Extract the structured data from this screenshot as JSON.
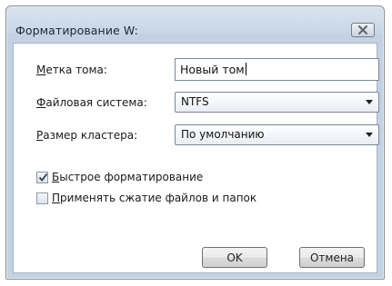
{
  "window": {
    "title": "Форматирование W:",
    "close_icon": "close-icon"
  },
  "form": {
    "volume_label": {
      "mnemonic": "М",
      "rest": "етка тома:",
      "value": "Новый том"
    },
    "filesystem": {
      "mnemonic": "Ф",
      "rest": "айловая система:",
      "selected": "NTFS"
    },
    "cluster_size": {
      "mnemonic": "Р",
      "rest": "азмер кластера:",
      "selected": "По умолчанию"
    }
  },
  "options": {
    "quick_format": {
      "mnemonic": "Б",
      "rest": "ыстрое форматирование",
      "checked": true
    },
    "compression": {
      "mnemonic": "П",
      "rest": "рименять сжатие файлов и папок",
      "checked": false
    }
  },
  "buttons": {
    "ok": "OK",
    "cancel": "Отмена"
  }
}
